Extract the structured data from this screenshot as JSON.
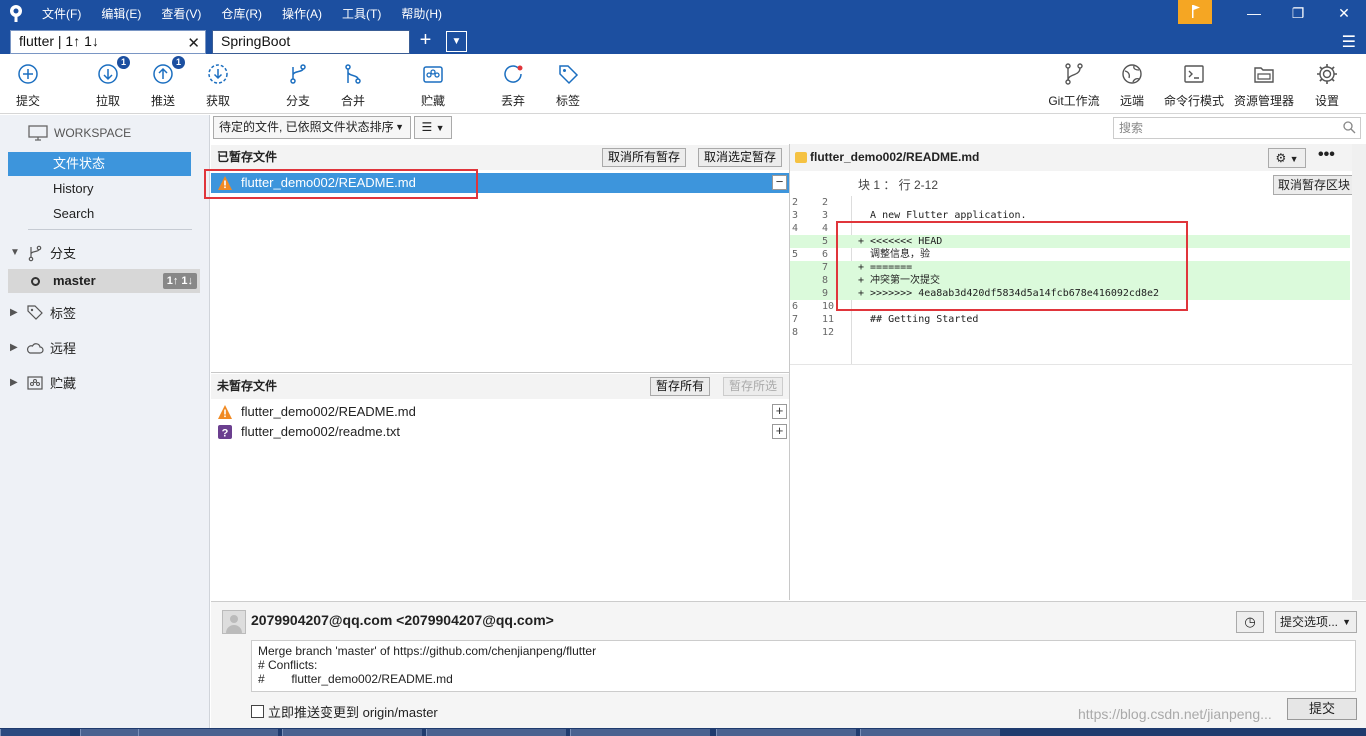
{
  "menu": [
    "文件(F)",
    "编辑(E)",
    "查看(V)",
    "仓库(R)",
    "操作(A)",
    "工具(T)",
    "帮助(H)"
  ],
  "tabs": [
    {
      "label": "flutter | 1↑ 1↓",
      "active": true
    },
    {
      "label": "SpringBoot",
      "active": false
    }
  ],
  "toolbar": {
    "commit": "提交",
    "pull": "拉取",
    "pull_badge": "1",
    "push": "推送",
    "push_badge": "1",
    "fetch": "获取",
    "branch": "分支",
    "merge": "合并",
    "stash": "贮藏",
    "discard": "丢弃",
    "tag": "标签",
    "gitflow": "Git工作流",
    "remote": "远端",
    "terminal": "命令行模式",
    "explorer": "资源管理器",
    "settings": "设置"
  },
  "search": {
    "placeholder": "搜索"
  },
  "sidebar": {
    "workspace": "WORKSPACE",
    "items": [
      "文件状态",
      "History",
      "Search"
    ],
    "branches_label": "分支",
    "branch_name": "master",
    "branch_count": "1↑ 1↓",
    "tags_label": "标签",
    "remotes_label": "远程",
    "stashes_label": "贮藏"
  },
  "filter": {
    "value": "待定的文件, 已依照文件状态排序",
    "view": "☰"
  },
  "staged": {
    "title": "已暂存文件",
    "unstage_all": "取消所有暂存",
    "unstage_selected": "取消选定暂存",
    "files": [
      {
        "name": "flutter_demo002/README.md",
        "status": "conflict"
      }
    ]
  },
  "unstaged": {
    "title": "未暂存文件",
    "stage_all": "暂存所有",
    "stage_selected": "暂存所选",
    "files": [
      {
        "name": "flutter_demo002/README.md",
        "status": "conflict"
      },
      {
        "name": "flutter_demo002/readme.txt",
        "status": "untracked"
      }
    ]
  },
  "diff": {
    "file": "flutter_demo002/README.md",
    "hunk_header": "块 1 ： 行 2-12",
    "unstage_hunk": "取消暂存区块",
    "lines": [
      {
        "old": "2",
        "new": "2",
        "text": "",
        "added": false
      },
      {
        "old": "3",
        "new": "3",
        "text": "  A new Flutter application.",
        "added": false
      },
      {
        "old": "4",
        "new": "4",
        "text": "",
        "added": false
      },
      {
        "old": "",
        "new": "5",
        "text": "+ <<<<<<< HEAD",
        "added": true
      },
      {
        "old": "5",
        "new": "6",
        "text": "  调整信息，验",
        "added": false
      },
      {
        "old": "",
        "new": "7",
        "text": "+ =======",
        "added": true
      },
      {
        "old": "",
        "new": "8",
        "text": "+ 冲突第一次提交",
        "added": true
      },
      {
        "old": "",
        "new": "9",
        "text": "+ >>>>>>> 4ea8ab3d420df5834d5a14fcb678e416092cd8e2",
        "added": true
      },
      {
        "old": "6",
        "new": "10",
        "text": "",
        "added": false
      },
      {
        "old": "7",
        "new": "11",
        "text": "  ## Getting Started",
        "added": false
      },
      {
        "old": "8",
        "new": "12",
        "text": "",
        "added": false
      }
    ]
  },
  "commit": {
    "author": "2079904207@qq.com <2079904207@qq.com>",
    "options": "提交选项...",
    "message_lines": [
      "Merge branch 'master' of https://github.com/chenjianpeng/flutter",
      "",
      "# Conflicts:",
      "#        flutter_demo002/README.md"
    ],
    "push_label": "立即推送变更到 origin/master",
    "submit": "提交"
  },
  "watermark": "https://blog.csdn.net/jianpeng..."
}
